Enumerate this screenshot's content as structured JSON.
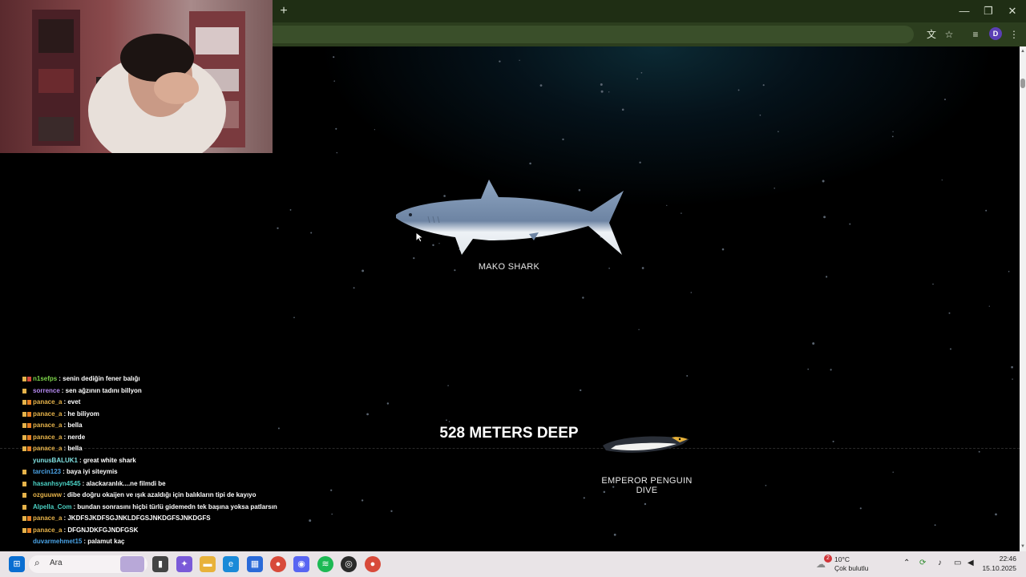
{
  "browser": {
    "new_tab_icon": "plus-icon",
    "window_controls": [
      "minimize-icon",
      "restore-icon",
      "close-icon"
    ],
    "toolbar_icons": [
      "translate-icon",
      "star-icon",
      "media-icon",
      "profile-icon",
      "menu-icon"
    ],
    "profile_initial": "D",
    "accent": "#2c3e1e"
  },
  "scene": {
    "creatures": [
      {
        "name": "MAKO SHARK"
      },
      {
        "name": "EMPEROR PENGUIN DIVE"
      }
    ],
    "depth_label": "528 METERS DEEP"
  },
  "chat": {
    "messages": [
      {
        "user": "n1sefps",
        "text": ": senin dediğin fener balığı",
        "color": "#7cd34a",
        "badges": [
          "gold",
          "red"
        ]
      },
      {
        "user": "sorrence",
        "text": ": sen ağzının tadını billyon",
        "color": "#b58af0",
        "badges": [
          "gold"
        ]
      },
      {
        "user": "panace_a",
        "text": ": evet",
        "color": "#e6b34a",
        "badges": [
          "gold",
          "orange"
        ]
      },
      {
        "user": "panace_a",
        "text": ": he biliyom",
        "color": "#e6b34a",
        "badges": [
          "gold",
          "orange"
        ]
      },
      {
        "user": "panace_a",
        "text": ": bella",
        "color": "#e6b34a",
        "badges": [
          "gold",
          "orange"
        ]
      },
      {
        "user": "panace_a",
        "text": ": nerde",
        "color": "#e6b34a",
        "badges": [
          "gold",
          "orange"
        ]
      },
      {
        "user": "panace_a",
        "text": ": bella",
        "color": "#e6b34a",
        "badges": [
          "gold",
          "orange"
        ]
      },
      {
        "user": "yunusBALUK1",
        "text": ": great white shark",
        "color": "#7fe0e0",
        "badges": []
      },
      {
        "user": "tarcin123",
        "text": ": baya iyi siteymis",
        "color": "#4aa3e6",
        "badges": [
          "gold"
        ]
      },
      {
        "user": "hasanhsyn4545",
        "text": ": alackaranlık....ne filmdi be",
        "color": "#4ad1c4",
        "badges": [
          "gold"
        ]
      },
      {
        "user": "ozguuww",
        "text": ": dibe doğru okaijen ve ışık azaldığı için balıkların tipi de kayıyo",
        "color": "#e6b34a",
        "badges": [
          "gold"
        ]
      },
      {
        "user": "Alpella_Com",
        "text": ": bundan sonrasını hiçbi türlü gidemedn tek başına yoksa patlarsın",
        "color": "#4ad1c4",
        "badges": [
          "gold"
        ]
      },
      {
        "user": "panace_a",
        "text": ": JKDFSJKDFSGJNKLDFGSJNKDGFSJNKDGFS",
        "color": "#e6b34a",
        "badges": [
          "gold",
          "orange"
        ]
      },
      {
        "user": "panace_a",
        "text": ": DFGNJDKFGJNDFGSK",
        "color": "#e6b34a",
        "badges": [
          "gold",
          "orange"
        ]
      },
      {
        "user": "duvarmehmet15",
        "text": ": palamut kaç",
        "color": "#4aa3e6",
        "badges": []
      }
    ]
  },
  "taskbar": {
    "search_placeholder": "Ara",
    "apps": [
      "windows-start-icon",
      "search-icon",
      "task-view-icon",
      "copilot-icon",
      "file-explorer-icon",
      "edge-icon",
      "store-icon",
      "chrome-icon",
      "discord-icon",
      "spotify-icon",
      "obs-icon",
      "chrome-profile-icon"
    ],
    "weather_temp": "10°C",
    "weather_desc": "Çok bulutlu",
    "weather_badge": "2",
    "time": "22:46",
    "date": "15.10.2025"
  }
}
